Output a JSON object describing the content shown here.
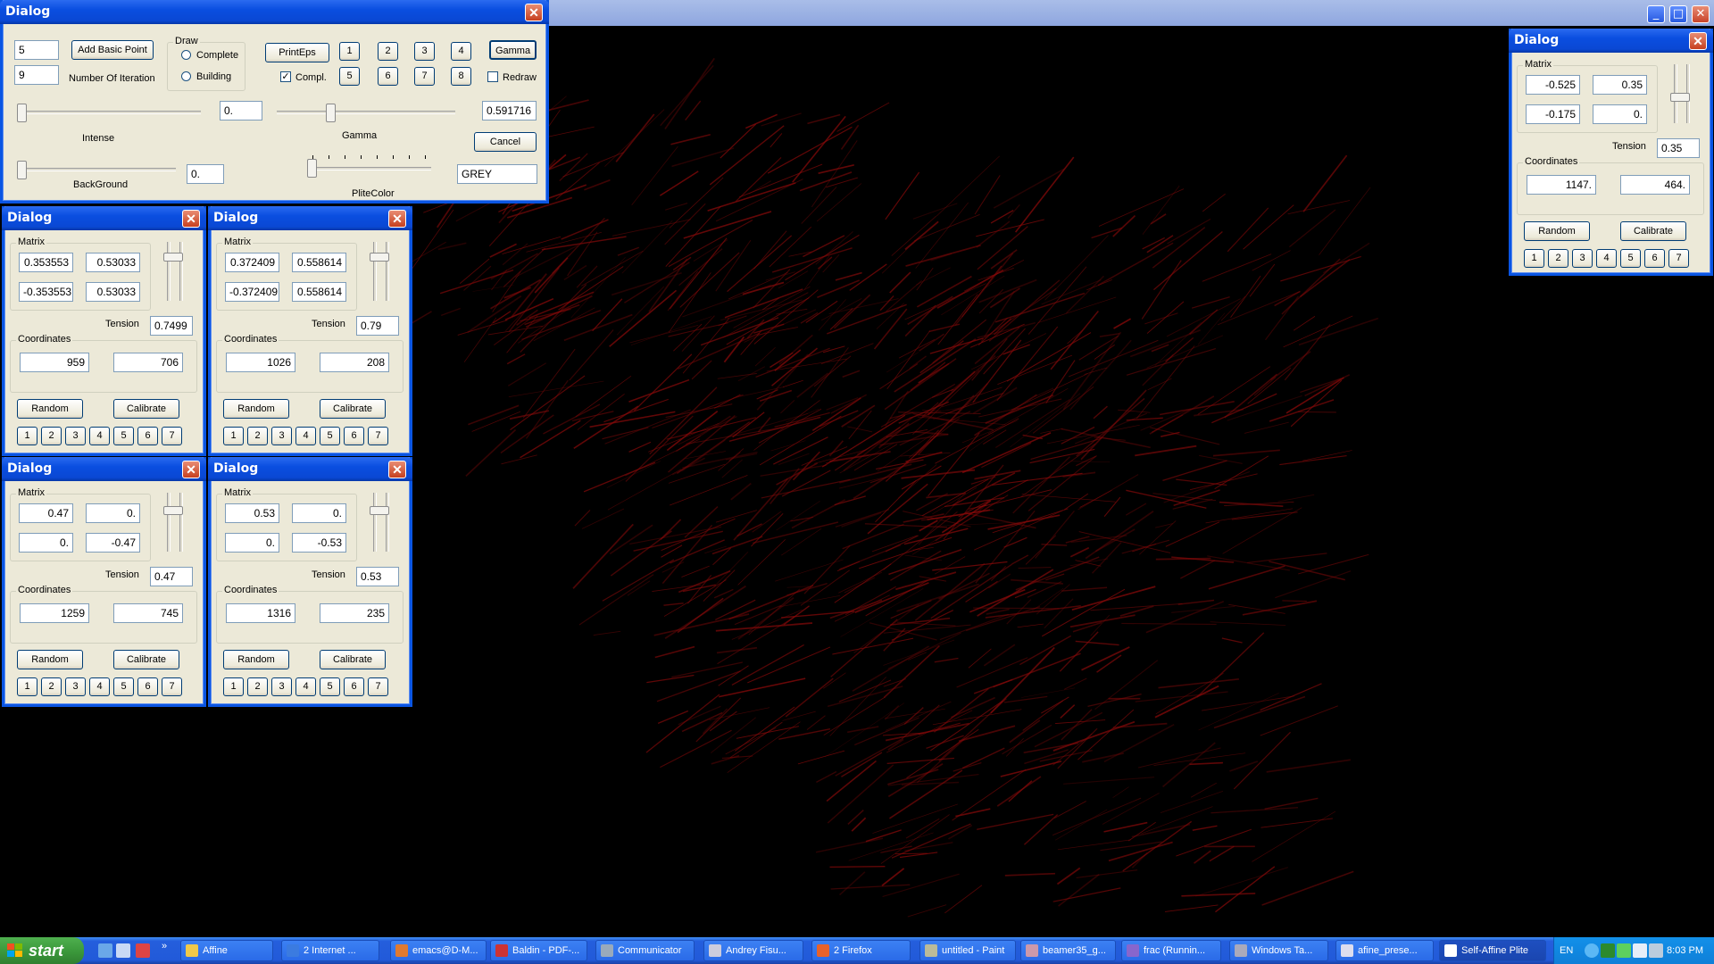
{
  "app": {
    "window_buttons": [
      "_",
      "□",
      "✕"
    ]
  },
  "main_dialog": {
    "title": "Dialog",
    "points_value": "5",
    "iterations_value": "9",
    "add_basic_point": "Add Basic Point",
    "iterations_label": "Number Of Iteration",
    "draw_group": "Draw",
    "complete_label": "Complete",
    "building_label": "Building",
    "printeps": "PrintEps",
    "compl_label": "Compl.",
    "compl_checked": "✓",
    "num_buttons": [
      "1",
      "2",
      "3",
      "4",
      "5",
      "6",
      "7",
      "8"
    ],
    "gamma_button": "Gamma",
    "redraw_label": "Redraw",
    "intense_value": "0.",
    "intense_label": "Intense",
    "gamma_value": "0.591716",
    "gamma_label": "Gamma",
    "cancel": "Cancel",
    "background_value": "0.",
    "background_label": "BackGround",
    "plitecolor_value": "GREY",
    "plitecolor_label": "PliteColor"
  },
  "affine_dialogs": [
    {
      "title": "Dialog",
      "matrix_label": "Matrix",
      "m": [
        "0.353553",
        "0.53033",
        "-0.353553",
        "0.53033"
      ],
      "tension_label": "Tension",
      "tension": "0.7499",
      "coords_label": "Coordinates",
      "x": "959",
      "y": "706",
      "random": "Random",
      "calibrate": "Calibrate",
      "nums": [
        "1",
        "2",
        "3",
        "4",
        "5",
        "6",
        "7"
      ]
    },
    {
      "title": "Dialog",
      "matrix_label": "Matrix",
      "m": [
        "0.372409",
        "0.558614",
        "-0.372409",
        "0.558614"
      ],
      "tension_label": "Tension",
      "tension": "0.79",
      "coords_label": "Coordinates",
      "x": "1026",
      "y": "208",
      "random": "Random",
      "calibrate": "Calibrate",
      "nums": [
        "1",
        "2",
        "3",
        "4",
        "5",
        "6",
        "7"
      ]
    },
    {
      "title": "Dialog",
      "matrix_label": "Matrix",
      "m": [
        "0.47",
        "0.",
        "0.",
        "-0.47"
      ],
      "tension_label": "Tension",
      "tension": "0.47",
      "coords_label": "Coordinates",
      "x": "1259",
      "y": "745",
      "random": "Random",
      "calibrate": "Calibrate",
      "nums": [
        "1",
        "2",
        "3",
        "4",
        "5",
        "6",
        "7"
      ]
    },
    {
      "title": "Dialog",
      "matrix_label": "Matrix",
      "m": [
        "0.53",
        "0.",
        "0.",
        "-0.53"
      ],
      "tension_label": "Tension",
      "tension": "0.53",
      "coords_label": "Coordinates",
      "x": "1316",
      "y": "235",
      "random": "Random",
      "calibrate": "Calibrate",
      "nums": [
        "1",
        "2",
        "3",
        "4",
        "5",
        "6",
        "7"
      ]
    },
    {
      "title": "Dialog",
      "matrix_label": "Matrix",
      "m": [
        "-0.525",
        "0.35",
        "-0.175",
        "0."
      ],
      "tension_label": "Tension",
      "tension": "0.35",
      "coords_label": "Coordinates",
      "x": "1147.",
      "y": "464.",
      "random": "Random",
      "calibrate": "Calibrate",
      "nums": [
        "1",
        "2",
        "3",
        "4",
        "5",
        "6",
        "7"
      ]
    }
  ],
  "taskbar": {
    "start": "start",
    "items": [
      "Affine",
      "2 Internet ...",
      "emacs@D-M...",
      "Baldin - PDF-...",
      "Communicator",
      "Andrey Fisu...",
      "2 Firefox",
      "untitled - Paint",
      "beamer35_g...",
      "frac (Runnin...",
      "Windows Ta...",
      "afine_prese...",
      "Self-Affine Plite"
    ],
    "lang": "EN",
    "clock": "8:03 PM"
  },
  "colors": {
    "fractal": "#8a0a0a",
    "title_blue": "#0a55e3",
    "dialog_bg": "#ece9d8",
    "taskbar": "#245edc",
    "start_green": "#3c9a3c"
  }
}
